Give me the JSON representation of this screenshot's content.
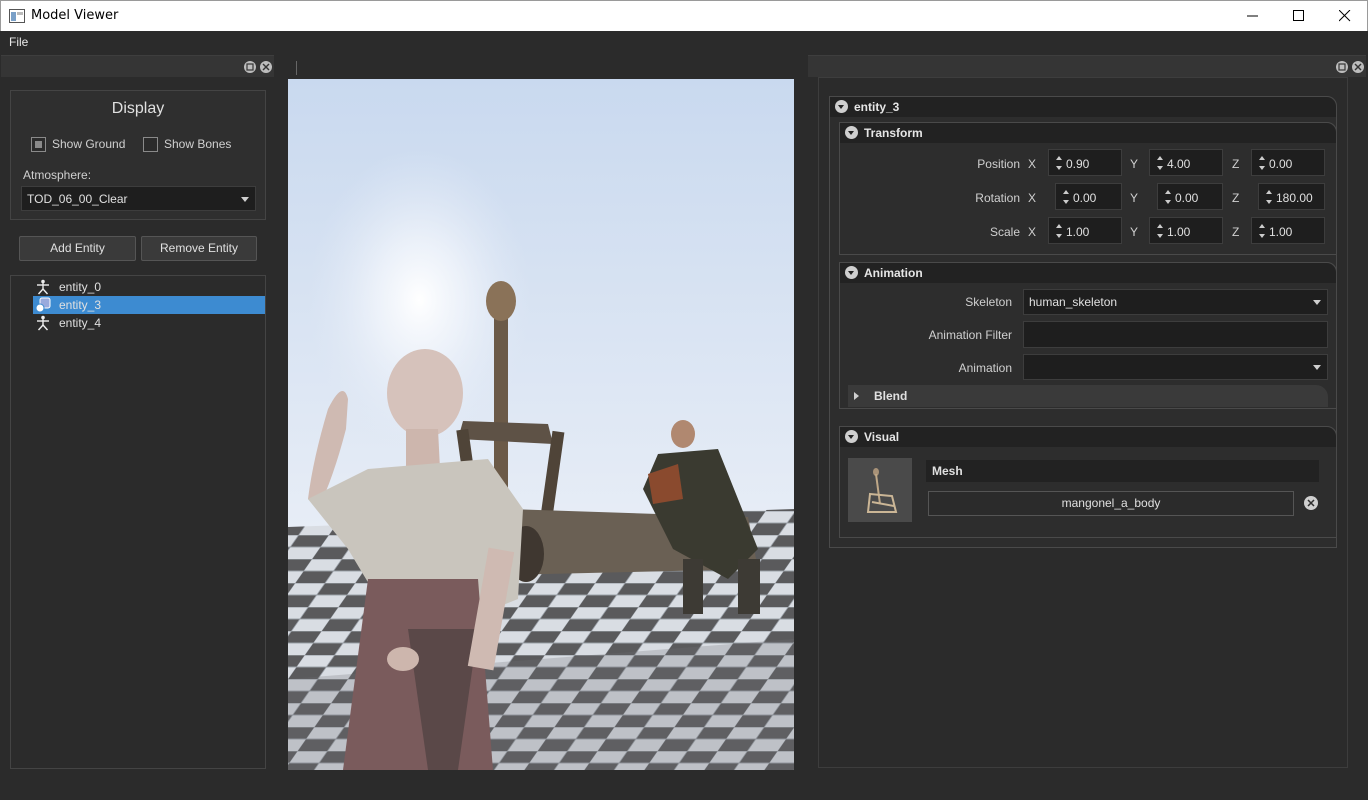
{
  "window": {
    "title": "Model Viewer"
  },
  "menu": {
    "file": "File"
  },
  "display": {
    "title": "Display",
    "show_ground": "Show Ground",
    "show_bones": "Show Bones",
    "atmosphere_label": "Atmosphere:",
    "atmosphere_value": "TOD_06_00_Clear"
  },
  "entity_buttons": {
    "add": "Add Entity",
    "remove": "Remove Entity"
  },
  "entities": [
    {
      "label": "entity_0",
      "selected": false
    },
    {
      "label": "entity_3",
      "selected": true
    },
    {
      "label": "entity_4",
      "selected": false
    }
  ],
  "inspector": {
    "entity_title": "entity_3",
    "transform": {
      "title": "Transform",
      "position": {
        "label": "Position",
        "x": "0.90",
        "y": "4.00",
        "z": "0.00"
      },
      "rotation": {
        "label": "Rotation",
        "x": "0.00",
        "y": "0.00",
        "z": "180.00"
      },
      "scale": {
        "label": "Scale",
        "x": "1.00",
        "y": "1.00",
        "z": "1.00"
      },
      "axis_x": "X",
      "axis_y": "Y",
      "axis_z": "Z"
    },
    "animation": {
      "title": "Animation",
      "skeleton_label": "Skeleton",
      "skeleton_value": "human_skeleton",
      "filter_label": "Animation Filter",
      "filter_value": "",
      "animation_label": "Animation",
      "animation_value": "",
      "blend_title": "Blend"
    },
    "visual": {
      "title": "Visual",
      "mesh_title": "Mesh",
      "mesh_value": "mangonel_a_body"
    }
  },
  "colors": {
    "background": "#2b2b2b",
    "selection": "#3d8bd1",
    "field": "#1e1e1e"
  }
}
